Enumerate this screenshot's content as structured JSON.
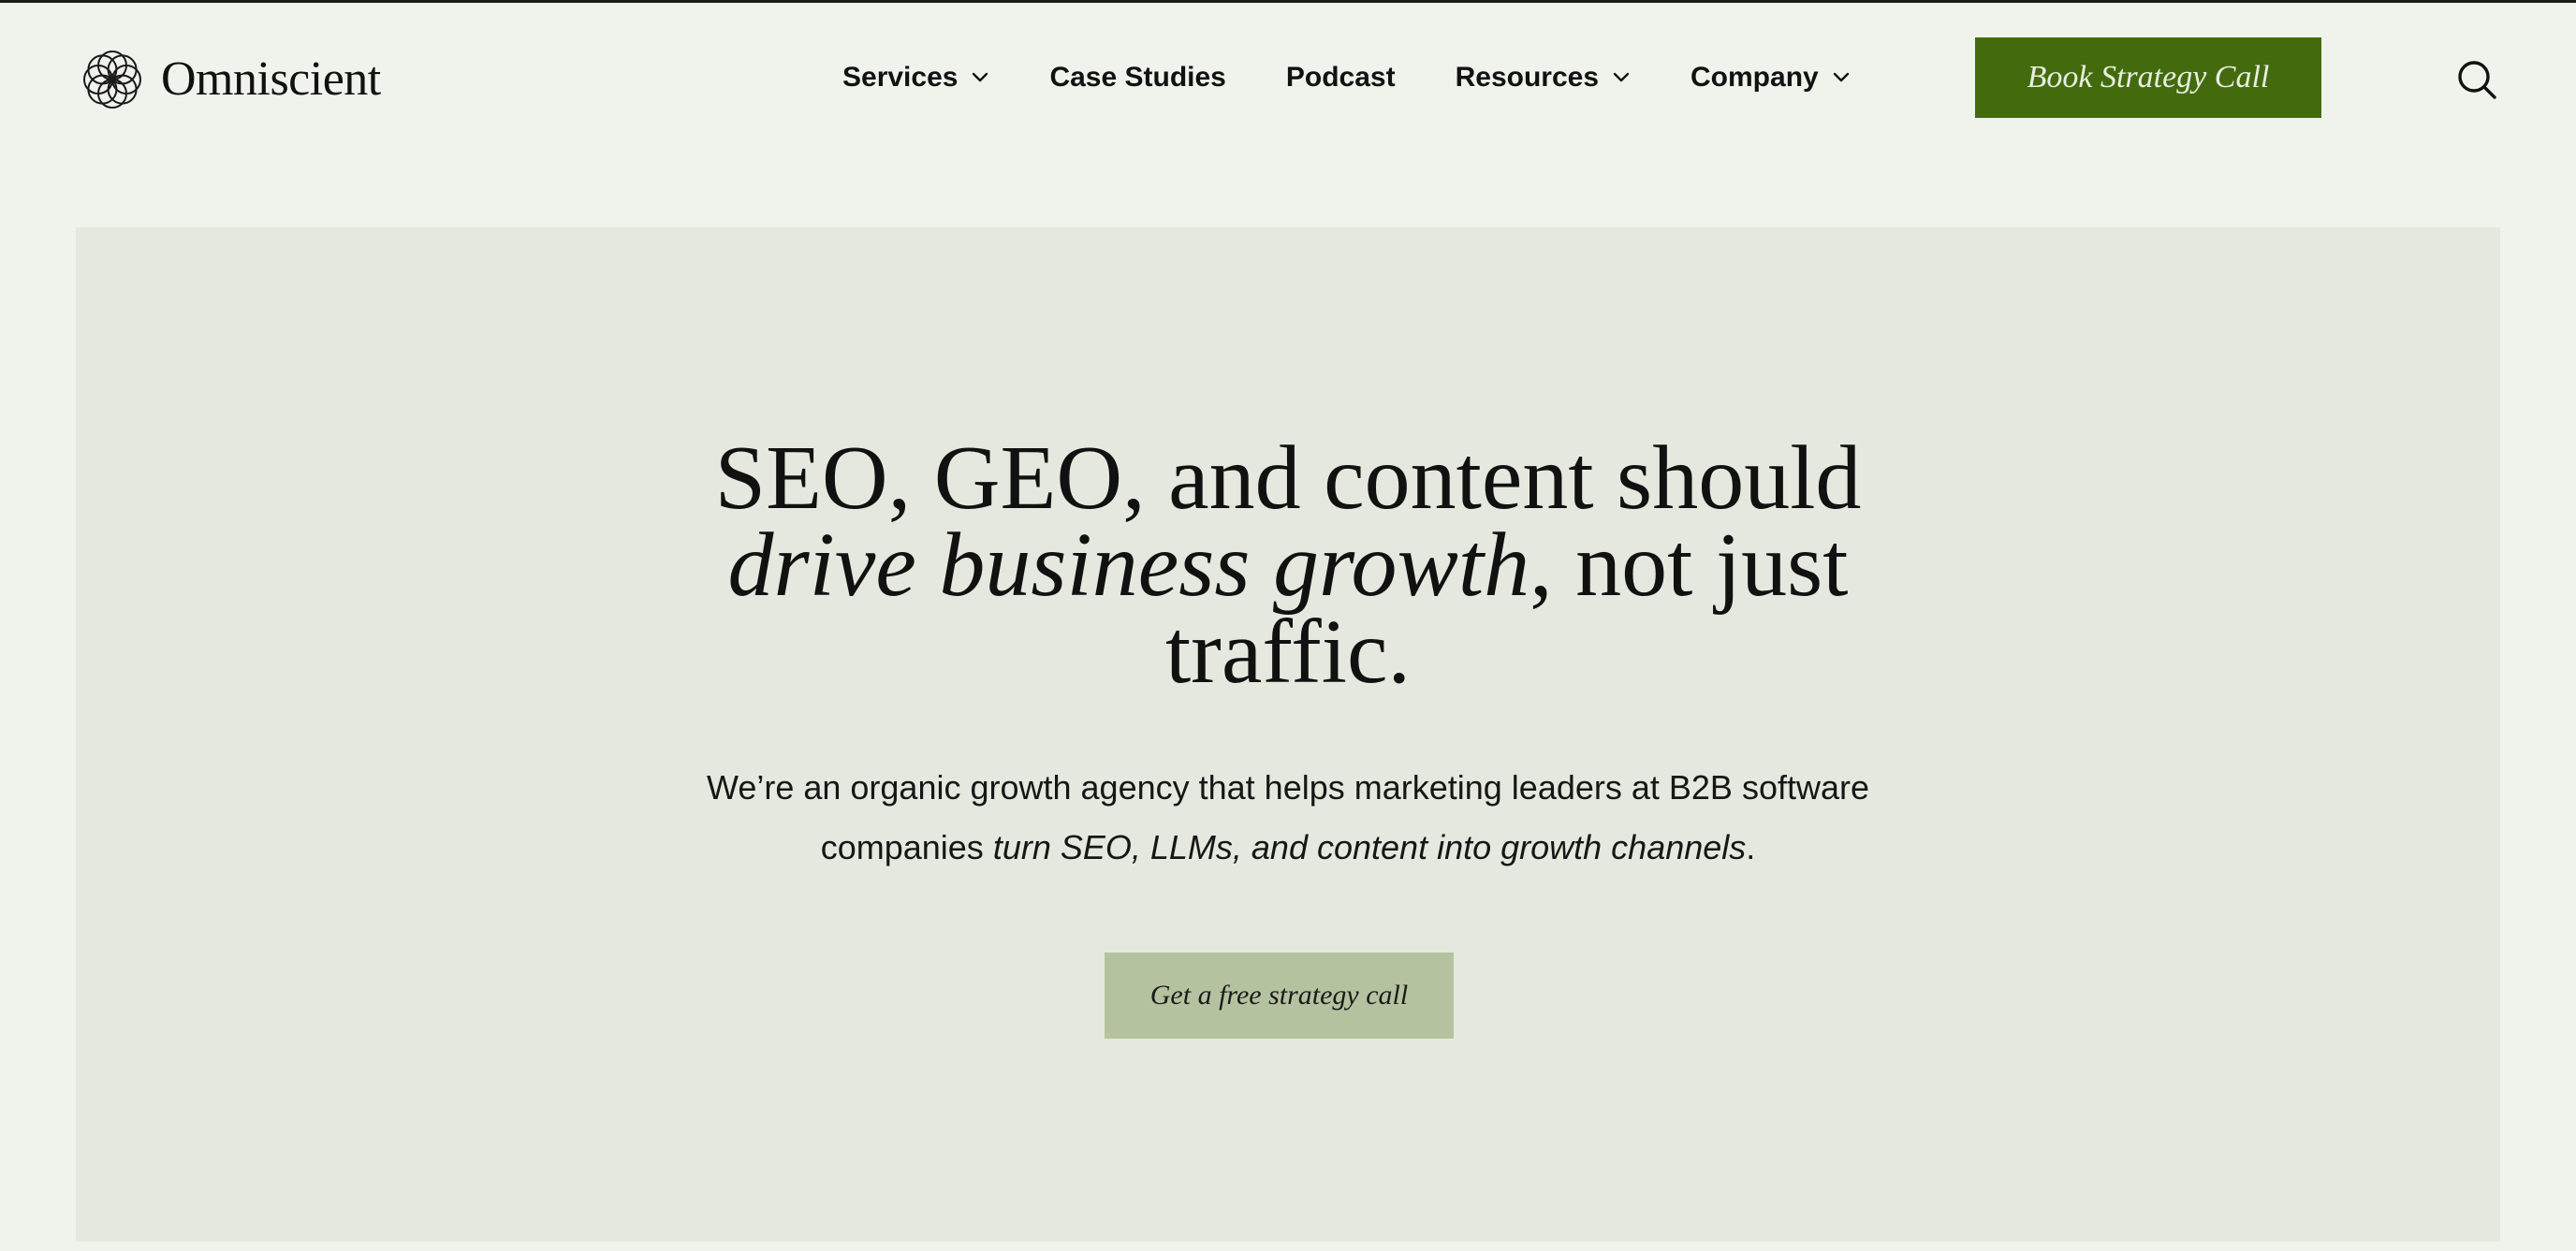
{
  "brand": {
    "name": "Omniscient"
  },
  "nav": {
    "items": [
      {
        "label": "Services",
        "has_dropdown": true
      },
      {
        "label": "Case Studies",
        "has_dropdown": false
      },
      {
        "label": "Podcast",
        "has_dropdown": false
      },
      {
        "label": "Resources",
        "has_dropdown": true
      },
      {
        "label": "Company",
        "has_dropdown": true
      }
    ],
    "cta_label": "Book Strategy Call",
    "search_icon": "search-icon"
  },
  "hero": {
    "title": {
      "line1": "SEO, GEO, and content should",
      "line2_emphasis": "drive business growth",
      "line2_rest": ", not just",
      "line3": "traffic."
    },
    "subtitle": {
      "line1": "We’re an organic growth agency that helps marketing leaders at B2B software",
      "line2_lead": "companies ",
      "line2_emphasis": "turn SEO, LLMs, and content into growth channels",
      "line2_end": "."
    },
    "cta_label": "Get a free strategy call"
  },
  "colors": {
    "page_background": "#f0f3ec",
    "hero_background": "#e5e8de",
    "primary_button": "#436b0e",
    "primary_button_text": "#e9efdf",
    "secondary_button": "#b5c2a0",
    "text": "#111111"
  }
}
